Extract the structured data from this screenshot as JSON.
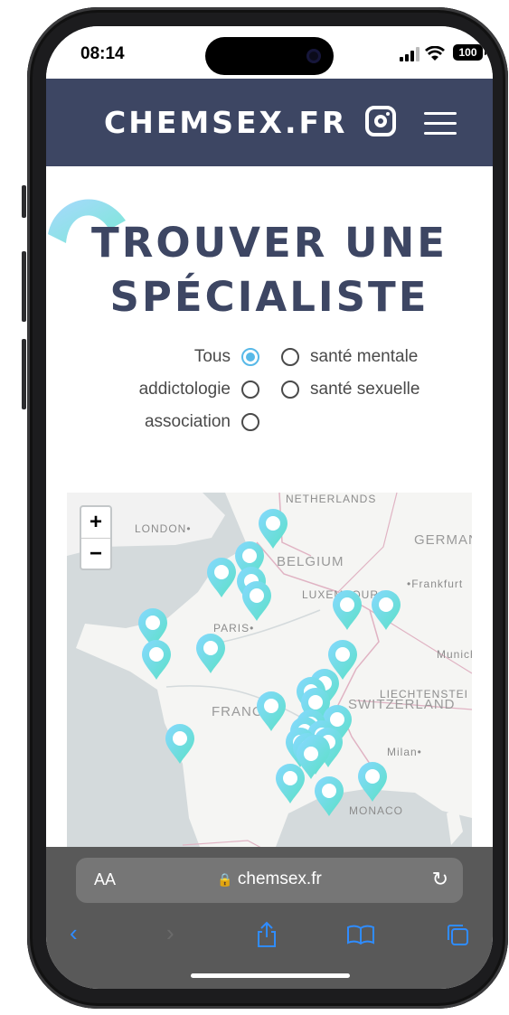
{
  "status": {
    "time": "08:14",
    "battery": "100"
  },
  "site": {
    "logo": "CHEMSEX.FR"
  },
  "page": {
    "title_line1": "TROUVER UNE",
    "title_line2": "SPÉCIALISTE"
  },
  "filters": [
    {
      "label": "Tous",
      "selected": true
    },
    {
      "label": "santé mentale",
      "selected": false
    },
    {
      "label": "addictologie",
      "selected": false
    },
    {
      "label": "santé sexuelle",
      "selected": false
    },
    {
      "label": "association",
      "selected": false
    }
  ],
  "map": {
    "zoom_in": "+",
    "zoom_out": "−",
    "labels": [
      "NETHERLANDS",
      "LONDON•",
      "GERMAN",
      "BELGIUM",
      "•Frankfurt",
      "LUXEMBOURG",
      "PARIS•",
      "Munich",
      "LIECHTENSTEI",
      "SWITZERLAND",
      "FRANCE",
      "Milan•",
      "MONACO"
    ],
    "marker_count": 28
  },
  "browser": {
    "aa": "AA",
    "url": "chemsex.fr"
  },
  "colors": {
    "header": "#3d4663",
    "accent": "#58b9e8",
    "marker_from": "#86d9ff",
    "marker_to": "#5ce0c6"
  }
}
